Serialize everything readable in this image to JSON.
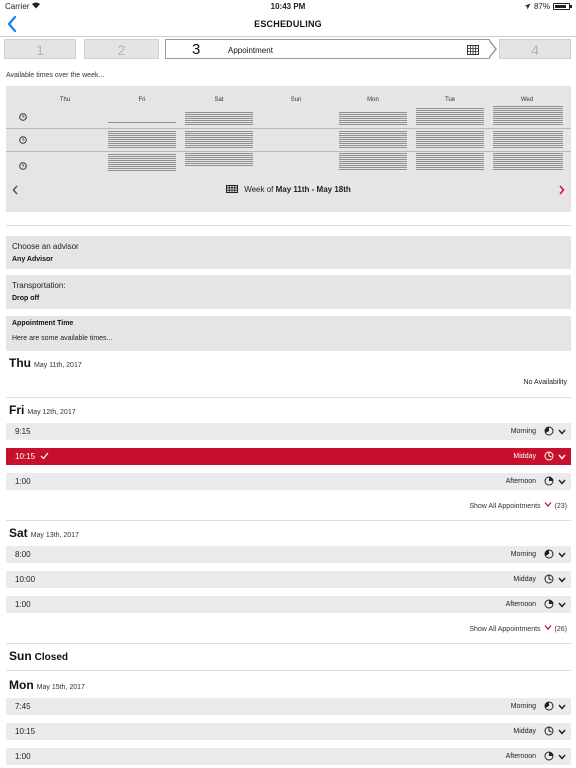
{
  "status": {
    "carrier": "Carrier",
    "time": "10:43 PM",
    "battery": "87%",
    "battery_level": 0.87
  },
  "nav": {
    "title": "ESCHEDULING"
  },
  "steps": [
    {
      "num": "1"
    },
    {
      "num": "2"
    },
    {
      "num": "3",
      "label": "Appointment"
    },
    {
      "num": "4"
    }
  ],
  "week": {
    "caption": "Available times over the week...",
    "days": [
      "Thu",
      "Fri",
      "Sat",
      "Sun",
      "Mon",
      "Tue",
      "Wed"
    ],
    "week_of_prefix": "Week of",
    "week_range": "May 11th - May 18th"
  },
  "advisor": {
    "label": "Choose an advisor",
    "value": "Any Advisor"
  },
  "transport": {
    "label": "Transportation:",
    "value": "Drop off"
  },
  "appt": {
    "label": "Appointment Time",
    "sub": "Here are some available times..."
  },
  "schedule": {
    "thu": {
      "day": "Thu",
      "date": "May 11th, 2017",
      "note": "No Availability"
    },
    "fri": {
      "day": "Fri",
      "date": "May 12th, 2017",
      "slots": [
        {
          "time": "9:15",
          "period": "Morning"
        },
        {
          "time": "10:15",
          "period": "Midday"
        },
        {
          "time": "1:00",
          "period": "Afternoon"
        }
      ],
      "show_all": "Show All Appointments",
      "count": "(23)"
    },
    "sat": {
      "day": "Sat",
      "date": "May 13th, 2017",
      "slots": [
        {
          "time": "8:00",
          "period": "Morning"
        },
        {
          "time": "10:00",
          "period": "Midday"
        },
        {
          "time": "1:00",
          "period": "Afternoon"
        }
      ],
      "show_all": "Show All Appointments",
      "count": "(26)"
    },
    "sun": {
      "day": "Sun",
      "closed": "Closed"
    },
    "mon": {
      "day": "Mon",
      "date": "May 15th, 2017",
      "slots": [
        {
          "time": "7:45",
          "period": "Morning"
        },
        {
          "time": "10:15",
          "period": "Midday"
        },
        {
          "time": "1:00",
          "period": "Afternoon"
        }
      ]
    }
  },
  "colors": {
    "accent": "#c8102e",
    "back": "#1a7cf2",
    "panel": "#e5e5e5"
  }
}
